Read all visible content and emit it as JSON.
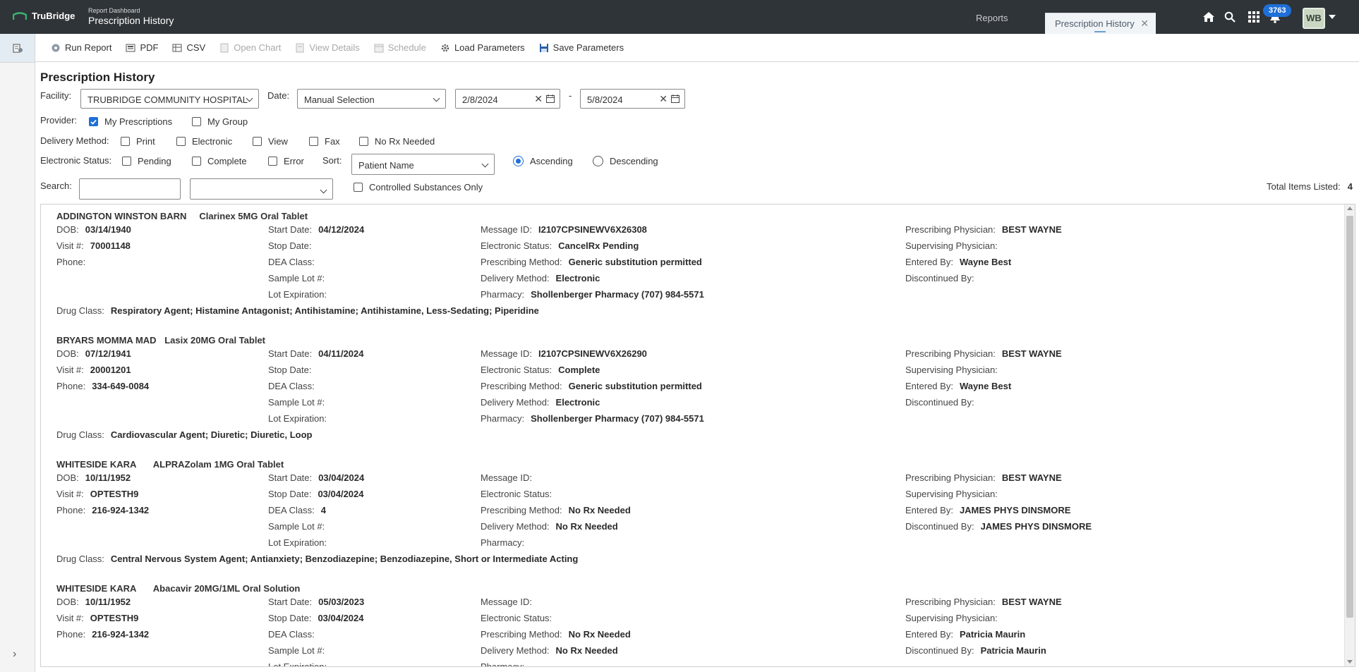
{
  "header": {
    "brand": "TruBridge",
    "subtitle": "Report Dashboard",
    "title": "Prescription History",
    "tabs": [
      "Reports",
      "Prescription History"
    ],
    "notification_count": "3763",
    "user_initials": "WB"
  },
  "toolbar": [
    {
      "label": "Run Report",
      "icon": "run-report-icon",
      "enabled": true
    },
    {
      "label": "PDF",
      "icon": "pdf-icon",
      "enabled": true
    },
    {
      "label": "CSV",
      "icon": "csv-icon",
      "enabled": true
    },
    {
      "label": "Open Chart",
      "icon": "open-chart-icon",
      "enabled": false
    },
    {
      "label": "View Details",
      "icon": "view-details-icon",
      "enabled": false
    },
    {
      "label": "Schedule",
      "icon": "schedule-icon",
      "enabled": false
    },
    {
      "label": "Load Parameters",
      "icon": "load-parameters-icon",
      "enabled": true
    },
    {
      "label": "Save Parameters",
      "icon": "save-icon",
      "enabled": true
    }
  ],
  "form": {
    "title": "Prescription History",
    "facility_label": "Facility:",
    "facility_value": "TRUBRIDGE COMMUNITY HOSPITAL",
    "date_label": "Date:",
    "date_mode": "Manual Selection",
    "date_from": "2/8/2024",
    "date_sep": "-",
    "date_to": "5/8/2024",
    "provider_label": "Provider:",
    "provider_options": [
      {
        "label": "My Prescriptions",
        "checked": true
      },
      {
        "label": "My Group",
        "checked": false
      }
    ],
    "delivery_label": "Delivery Method:",
    "delivery_options": [
      {
        "label": "Print",
        "checked": false
      },
      {
        "label": "Electronic",
        "checked": false
      },
      {
        "label": "View",
        "checked": false
      },
      {
        "label": "Fax",
        "checked": false
      },
      {
        "label": "No Rx Needed",
        "checked": false
      }
    ],
    "estatus_label": "Electronic Status:",
    "estatus_options": [
      {
        "label": "Pending",
        "checked": false
      },
      {
        "label": "Complete",
        "checked": false
      },
      {
        "label": "Error",
        "checked": false
      }
    ],
    "sort_label": "Sort:",
    "sort_value": "Patient Name",
    "order_options": [
      {
        "label": "Ascending",
        "checked": true
      },
      {
        "label": "Descending",
        "checked": false
      }
    ],
    "search_label": "Search:",
    "search_value": "",
    "search_field_value": "",
    "controlled_label": "Controlled Substances Only",
    "controlled_checked": false,
    "total_label": "Total Items Listed:",
    "total_value": "4"
  },
  "field_labels": {
    "dob": "DOB:",
    "visit": "Visit #:",
    "phone": "Phone:",
    "start": "Start Date:",
    "stop": "Stop Date:",
    "dea": "DEA Class:",
    "lot": "Sample Lot #:",
    "lotexp": "Lot Expiration:",
    "msgid": "Message ID:",
    "estatus": "Electronic Status:",
    "pmethod": "Prescribing Method:",
    "dmethod": "Delivery Method:",
    "pharmacy": "Pharmacy:",
    "prescriber": "Prescribing Physician:",
    "supervisor": "Supervising Physician:",
    "entered": "Entered By:",
    "discontinued": "Discontinued By:",
    "drugclass": "Drug Class:"
  },
  "records": [
    {
      "name": "ADDINGTON WINSTON BARN",
      "drug": "Clarinex 5MG Oral Tablet",
      "dob": "03/14/1940",
      "visit": "70001148",
      "phone": "",
      "start": "04/12/2024",
      "stop": "",
      "dea": "",
      "lot": "",
      "lotexp": "",
      "msgid": "I2107CPSINEWV6X26308",
      "estatus": "CancelRx Pending",
      "pmethod": "Generic substitution permitted",
      "dmethod": "Electronic",
      "pharmacy": "Shollenberger Pharmacy (707) 984-5571",
      "prescriber": "BEST WAYNE",
      "supervisor": "",
      "entered": "Wayne Best",
      "discontinued": "",
      "drugclass": "Respiratory Agent; Histamine Antagonist; Antihistamine; Antihistamine, Less-Sedating; Piperidine"
    },
    {
      "name": "BRYARS MOMMA MAD",
      "drug": "Lasix 20MG Oral Tablet",
      "dob": "07/12/1941",
      "visit": "20001201",
      "phone": "334-649-0084",
      "start": "04/11/2024",
      "stop": "",
      "dea": "",
      "lot": "",
      "lotexp": "",
      "msgid": "I2107CPSINEWV6X26290",
      "estatus": "Complete",
      "pmethod": "Generic substitution permitted",
      "dmethod": "Electronic",
      "pharmacy": "Shollenberger Pharmacy (707) 984-5571",
      "prescriber": "BEST WAYNE",
      "supervisor": "",
      "entered": "Wayne Best",
      "discontinued": "",
      "drugclass": "Cardiovascular Agent; Diuretic; Diuretic, Loop"
    },
    {
      "name": "WHITESIDE KARA",
      "drug": "ALPRAZolam 1MG Oral Tablet",
      "dob": "10/11/1952",
      "visit": "OPTESTH9",
      "phone": "216-924-1342",
      "start": "03/04/2024",
      "stop": "03/04/2024",
      "dea": "4",
      "lot": "",
      "lotexp": "",
      "msgid": "",
      "estatus": "",
      "pmethod": "No Rx Needed",
      "dmethod": "No Rx Needed",
      "pharmacy": "",
      "prescriber": "BEST WAYNE",
      "supervisor": "",
      "entered": "JAMES PHYS DINSMORE",
      "discontinued": "JAMES PHYS DINSMORE",
      "drugclass": "Central Nervous System Agent; Antianxiety; Benzodiazepine; Benzodiazepine, Short or Intermediate Acting"
    },
    {
      "name": "WHITESIDE KARA",
      "drug": "Abacavir 20MG/1ML Oral Solution",
      "dob": "10/11/1952",
      "visit": "OPTESTH9",
      "phone": "216-924-1342",
      "start": "05/03/2023",
      "stop": "03/04/2024",
      "dea": "",
      "lot": "",
      "lotexp": "",
      "msgid": "",
      "estatus": "",
      "pmethod": "No Rx Needed",
      "dmethod": "No Rx Needed",
      "pharmacy": "",
      "prescriber": "BEST WAYNE",
      "supervisor": "",
      "entered": "Patricia Maurin",
      "discontinued": "Patricia Maurin",
      "drugclass": ""
    }
  ]
}
